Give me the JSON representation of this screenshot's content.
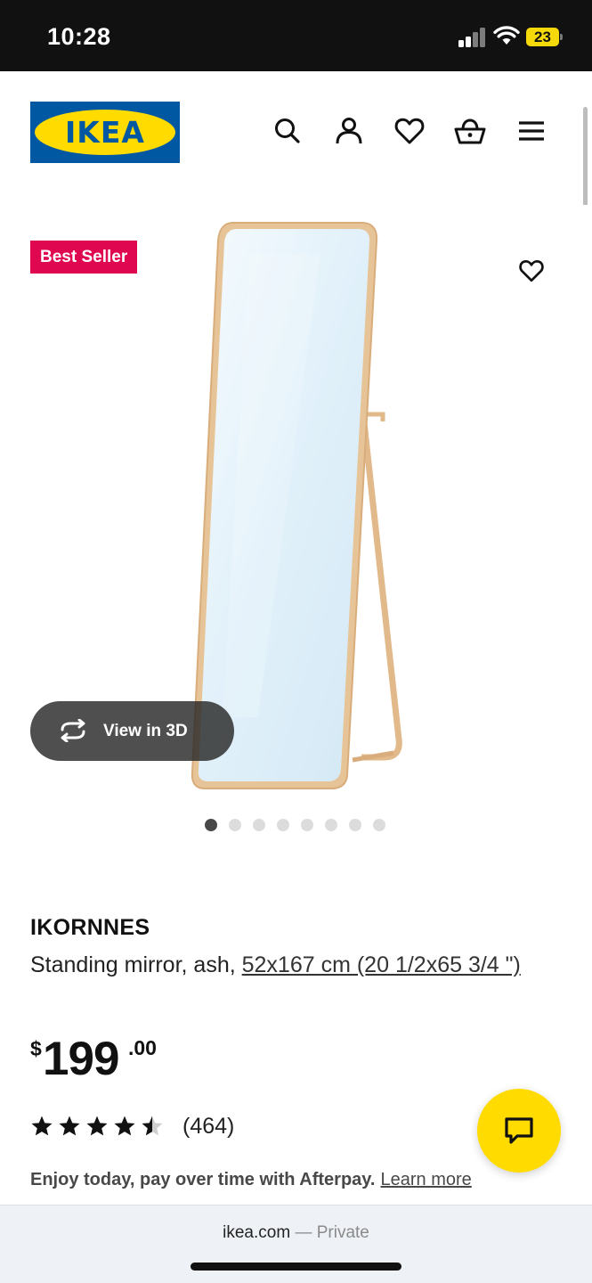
{
  "status_bar": {
    "time": "10:28",
    "battery": "23"
  },
  "header": {
    "logo_text": "IKEA",
    "icons": [
      "search-icon",
      "account-icon",
      "heart-icon",
      "basket-icon",
      "menu-icon"
    ]
  },
  "gallery": {
    "badge": "Best Seller",
    "view_3d_label": "View in 3D",
    "dot_count": 8,
    "active_dot": 0
  },
  "product": {
    "name": "IKORNNES",
    "description_prefix": "Standing mirror, ash,",
    "size_link": "52x167 cm (20 1/2x65 3/4 \")",
    "price": {
      "currency": "$",
      "integer": "199",
      "decimals": ".00"
    },
    "rating": {
      "stars": 4.5,
      "max": 5,
      "count": "(464)"
    },
    "afterpay_text": "Enjoy today, pay over time with Afterpay.",
    "afterpay_link": "Learn more"
  },
  "browser": {
    "domain": "ikea.com",
    "separator": "—",
    "mode": "Private"
  },
  "colors": {
    "ikea_blue": "#0058a3",
    "ikea_yellow": "#ffdb00",
    "badge_red": "#e00751",
    "frame_wood": "#e2b98a"
  }
}
